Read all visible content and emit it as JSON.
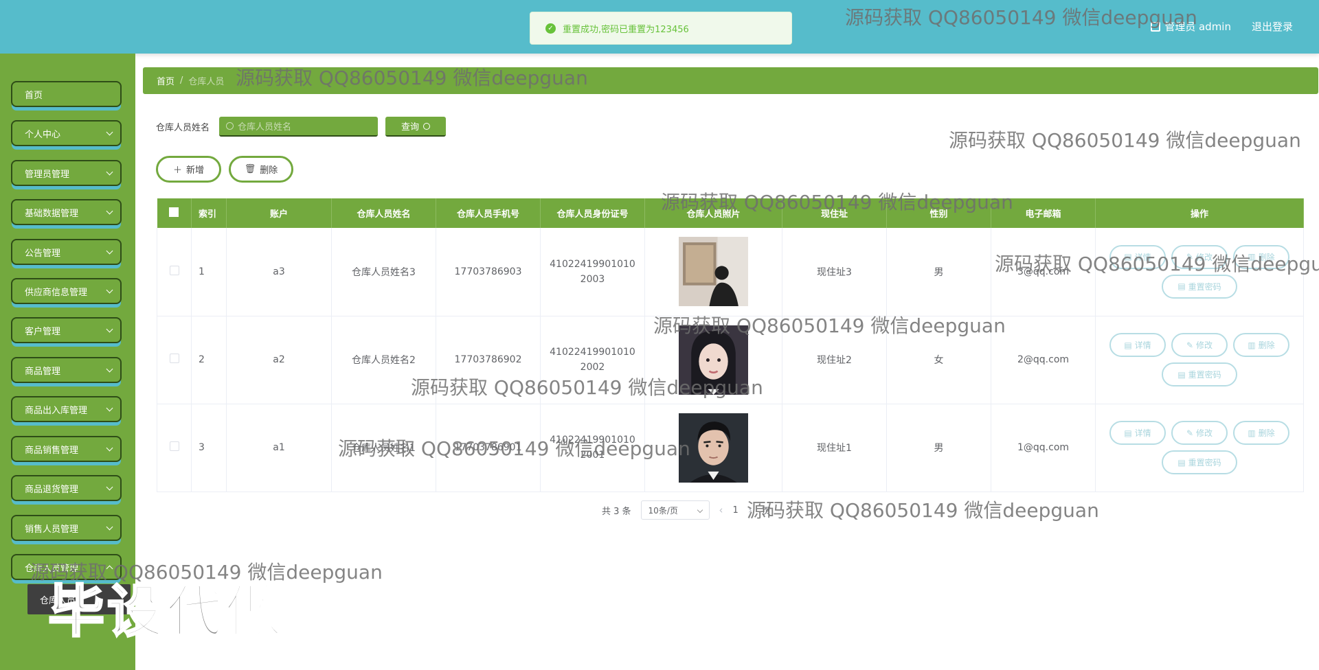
{
  "header": {
    "user_label": "管理员 admin",
    "logout_label": "退出登录",
    "toast": "重置成功,密码已重置为123456"
  },
  "sidebar": {
    "items": [
      {
        "label": "首页",
        "has_children": false
      },
      {
        "label": "个人中心",
        "has_children": true
      },
      {
        "label": "管理员管理",
        "has_children": true
      },
      {
        "label": "基础数据管理",
        "has_children": true
      },
      {
        "label": "公告管理",
        "has_children": true
      },
      {
        "label": "供应商信息管理",
        "has_children": true
      },
      {
        "label": "客户管理",
        "has_children": true
      },
      {
        "label": "商品管理",
        "has_children": true
      },
      {
        "label": "商品出入库管理",
        "has_children": true
      },
      {
        "label": "商品销售管理",
        "has_children": true
      },
      {
        "label": "商品退货管理",
        "has_children": true
      },
      {
        "label": "销售人员管理",
        "has_children": true
      },
      {
        "label": "仓库人员管理",
        "has_children": true
      }
    ],
    "active_sub": "仓库人员"
  },
  "breadcrumb": {
    "home": "首页",
    "separator": "/",
    "current": "仓库人员"
  },
  "search": {
    "label": "仓库人员姓名",
    "placeholder": "仓库人员姓名",
    "query_label": "查询"
  },
  "actions": {
    "add_label": "新增",
    "delete_label": "删除"
  },
  "table": {
    "columns": [
      "索引",
      "账户",
      "仓库人员姓名",
      "仓库人员手机号",
      "仓库人员身份证号",
      "仓库人员照片",
      "现住址",
      "性别",
      "电子邮箱",
      "操作"
    ],
    "rows": [
      {
        "index": "1",
        "account": "a3",
        "name": "仓库人员姓名3",
        "phone": "17703786903",
        "id_card": "410224199010102003",
        "address": "现住址3",
        "gender": "男",
        "email": "3@qq.com"
      },
      {
        "index": "2",
        "account": "a2",
        "name": "仓库人员姓名2",
        "phone": "17703786902",
        "id_card": "410224199010102002",
        "address": "现住址2",
        "gender": "女",
        "email": "2@qq.com"
      },
      {
        "index": "3",
        "account": "a1",
        "name": "仓库人员姓名1",
        "phone": "17703786901",
        "id_card": "410224199010102001",
        "address": "现住址1",
        "gender": "男",
        "email": "1@qq.com"
      }
    ],
    "row_actions": {
      "detail": "详情",
      "edit": "修改",
      "delete": "删除",
      "reset": "重置密码"
    }
  },
  "pager": {
    "total": "共 3 条",
    "page_size": "10条/页",
    "current_page": "1",
    "suffix": "页"
  },
  "watermark": {
    "text": "源码获取 QQ86050149 微信deepguan",
    "big": "毕设代做"
  },
  "colors": {
    "header": "#56bccb",
    "green": "#73a93e",
    "dark_border": "#2e4d17",
    "success": "#67c23a"
  }
}
